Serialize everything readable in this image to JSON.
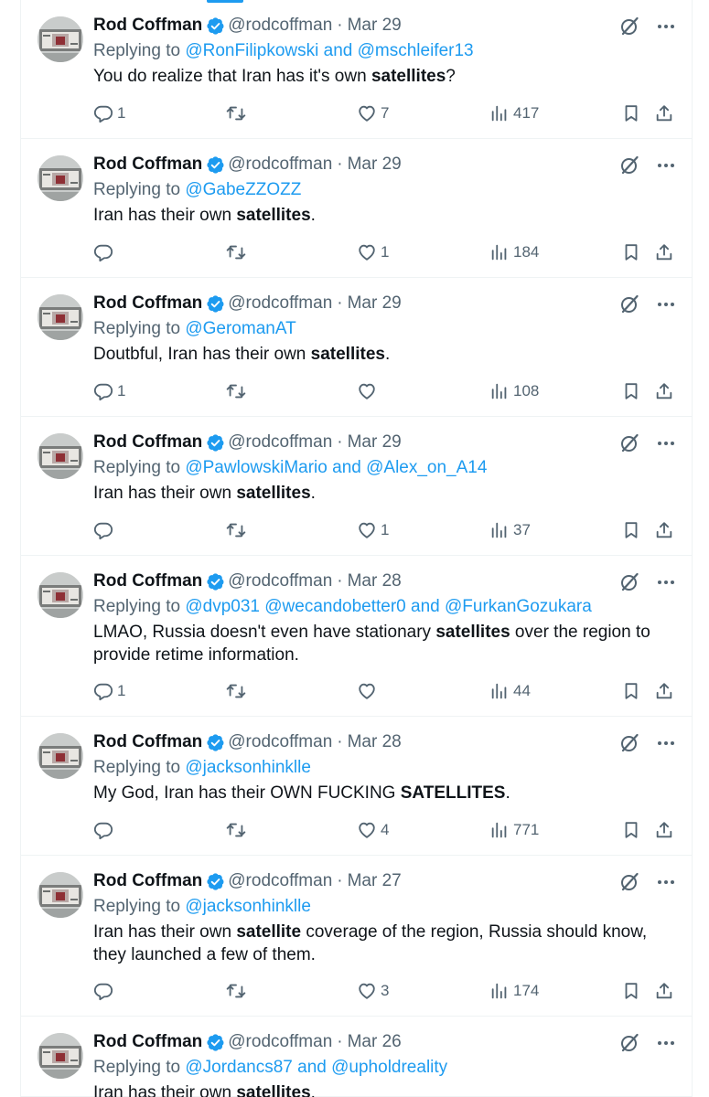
{
  "colors": {
    "accent": "#1d9bf0",
    "muted": "#536471",
    "text": "#0f1419",
    "border": "#eff3f4"
  },
  "icons": {
    "verified": "verified-badge-icon",
    "grok": "grok-icon",
    "more": "more-icon",
    "reply": "reply-icon",
    "retweet": "retweet-icon",
    "like": "heart-icon",
    "views": "views-icon",
    "bookmark": "bookmark-icon",
    "share": "share-icon"
  },
  "tweets": [
    {
      "name": "Rod Coffman",
      "handle": "@rodcoffman",
      "date": "Mar 29",
      "replying_prefix": "Replying to ",
      "replying": [
        {
          "link": "@RonFilipkowski"
        },
        {
          "sep": " and "
        },
        {
          "link": "@mschleifer13"
        }
      ],
      "text": [
        {
          "t": "You do realize that Iran has it's own "
        },
        {
          "b": "satellites"
        },
        {
          "t": "?"
        }
      ],
      "replies": "1",
      "retweets": "",
      "likes": "7",
      "views": "417"
    },
    {
      "name": "Rod Coffman",
      "handle": "@rodcoffman",
      "date": "Mar 29",
      "replying_prefix": "Replying to ",
      "replying": [
        {
          "link": "@GabeZZOZZ"
        }
      ],
      "text": [
        {
          "t": "Iran has their own "
        },
        {
          "b": "satellites"
        },
        {
          "t": "."
        }
      ],
      "replies": "",
      "retweets": "",
      "likes": "1",
      "views": "184"
    },
    {
      "name": "Rod Coffman",
      "handle": "@rodcoffman",
      "date": "Mar 29",
      "replying_prefix": "Replying to ",
      "replying": [
        {
          "link": "@GeromanAT"
        }
      ],
      "text": [
        {
          "t": "Doutbful, Iran has their own "
        },
        {
          "b": "satellites"
        },
        {
          "t": "."
        }
      ],
      "replies": "1",
      "retweets": "",
      "likes": "",
      "views": "108"
    },
    {
      "name": "Rod Coffman",
      "handle": "@rodcoffman",
      "date": "Mar 29",
      "replying_prefix": "Replying to ",
      "replying": [
        {
          "link": "@PawlowskiMario"
        },
        {
          "sep": " and "
        },
        {
          "link": "@Alex_on_A14"
        }
      ],
      "text": [
        {
          "t": "Iran has their own "
        },
        {
          "b": "satellites"
        },
        {
          "t": "."
        }
      ],
      "replies": "",
      "retweets": "",
      "likes": "1",
      "views": "37"
    },
    {
      "name": "Rod Coffman",
      "handle": "@rodcoffman",
      "date": "Mar 28",
      "replying_prefix": "Replying to ",
      "replying": [
        {
          "link": "@dvp031"
        },
        {
          "sep": " "
        },
        {
          "link": "@wecandobetter0"
        },
        {
          "sep": " and "
        },
        {
          "link": "@FurkanGozukara"
        }
      ],
      "text": [
        {
          "t": "LMAO, Russia doesn't even have stationary "
        },
        {
          "b": "satellites"
        },
        {
          "t": " over the region to provide retime information."
        }
      ],
      "replies": "1",
      "retweets": "",
      "likes": "",
      "views": "44"
    },
    {
      "name": "Rod Coffman",
      "handle": "@rodcoffman",
      "date": "Mar 28",
      "replying_prefix": "Replying to ",
      "replying": [
        {
          "link": "@jacksonhinklle"
        }
      ],
      "text": [
        {
          "t": "My God, Iran has their OWN FUCKING "
        },
        {
          "b": "SATELLITES"
        },
        {
          "t": "."
        }
      ],
      "replies": "",
      "retweets": "",
      "likes": "4",
      "views": "771"
    },
    {
      "name": "Rod Coffman",
      "handle": "@rodcoffman",
      "date": "Mar 27",
      "replying_prefix": "Replying to ",
      "replying": [
        {
          "link": "@jacksonhinklle"
        }
      ],
      "text": [
        {
          "t": "Iran has their own "
        },
        {
          "b": "satellite"
        },
        {
          "t": " coverage of the region, Russia should know, they launched a few of them."
        }
      ],
      "replies": "",
      "retweets": "",
      "likes": "3",
      "views": "174"
    },
    {
      "name": "Rod Coffman",
      "handle": "@rodcoffman",
      "date": "Mar 26",
      "replying_prefix": "Replying to ",
      "replying": [
        {
          "link": "@Jordancs87"
        },
        {
          "sep": " and "
        },
        {
          "link": "@upholdreality"
        }
      ],
      "text": [
        {
          "t": "Iran has their own "
        },
        {
          "b": "satellites"
        },
        {
          "t": "."
        }
      ],
      "replies": "",
      "retweets": "",
      "likes": "",
      "views": ""
    }
  ]
}
